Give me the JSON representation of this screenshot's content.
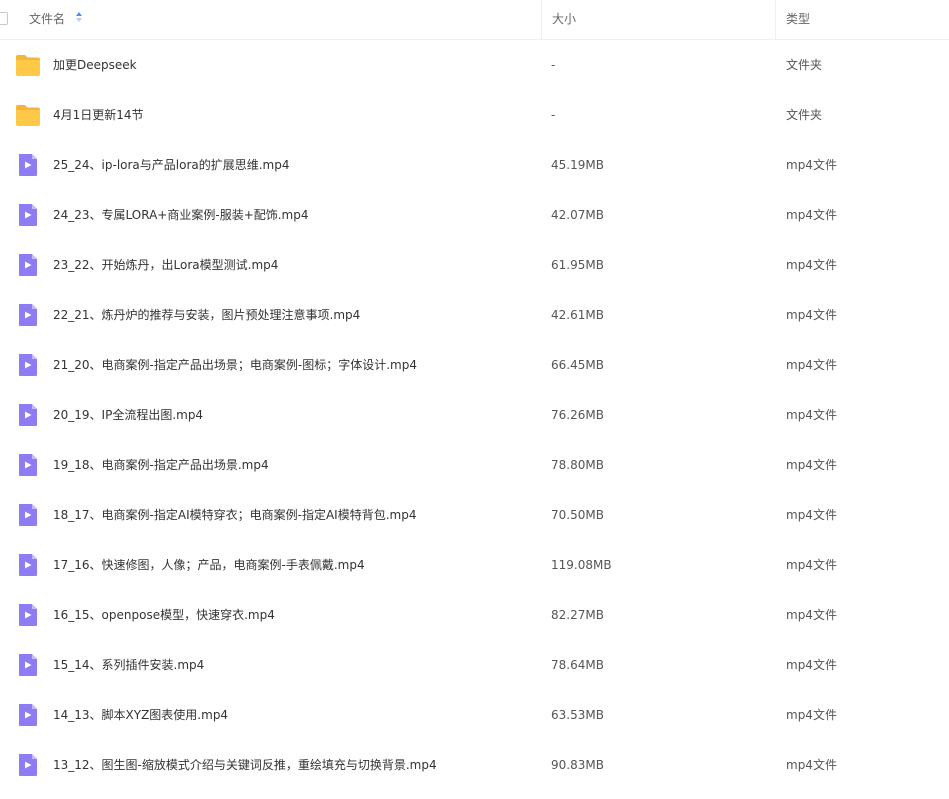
{
  "header": {
    "name_label": "文件名",
    "size_label": "大小",
    "type_label": "类型"
  },
  "rows": [
    {
      "kind": "folder",
      "icon": "folder-icon",
      "name": "加更Deepseek",
      "size": "-",
      "type": "文件夹"
    },
    {
      "kind": "folder",
      "icon": "folder-icon",
      "name": "4月1日更新14节",
      "size": "-",
      "type": "文件夹"
    },
    {
      "kind": "video",
      "icon": "video-file-icon",
      "name": "25_24、ip-lora与产品lora的扩展思维.mp4",
      "size": "45.19MB",
      "type": "mp4文件"
    },
    {
      "kind": "video",
      "icon": "video-file-icon",
      "name": "24_23、专属LORA+商业案例-服装+配饰.mp4",
      "size": "42.07MB",
      "type": "mp4文件"
    },
    {
      "kind": "video",
      "icon": "video-file-icon",
      "name": "23_22、开始炼丹，出Lora模型测试.mp4",
      "size": "61.95MB",
      "type": "mp4文件"
    },
    {
      "kind": "video",
      "icon": "video-file-icon",
      "name": "22_21、炼丹炉的推荐与安装，图片预处理注意事项.mp4",
      "size": "42.61MB",
      "type": "mp4文件"
    },
    {
      "kind": "video",
      "icon": "video-file-icon",
      "name": "21_20、电商案例-指定产品出场景；电商案例-图标；字体设计.mp4",
      "size": "66.45MB",
      "type": "mp4文件"
    },
    {
      "kind": "video",
      "icon": "video-file-icon",
      "name": "20_19、IP全流程出图.mp4",
      "size": "76.26MB",
      "type": "mp4文件"
    },
    {
      "kind": "video",
      "icon": "video-file-icon",
      "name": "19_18、电商案例-指定产品出场景.mp4",
      "size": "78.80MB",
      "type": "mp4文件"
    },
    {
      "kind": "video",
      "icon": "video-file-icon",
      "name": "18_17、电商案例-指定AI模特穿衣；电商案例-指定AI模特背包.mp4",
      "size": "70.50MB",
      "type": "mp4文件"
    },
    {
      "kind": "video",
      "icon": "video-file-icon",
      "name": "17_16、快速修图，人像；产品，电商案例-手表佩戴.mp4",
      "size": "119.08MB",
      "type": "mp4文件"
    },
    {
      "kind": "video",
      "icon": "video-file-icon",
      "name": "16_15、openpose模型，快速穿衣.mp4",
      "size": "82.27MB",
      "type": "mp4文件"
    },
    {
      "kind": "video",
      "icon": "video-file-icon",
      "name": "15_14、系列插件安装.mp4",
      "size": "78.64MB",
      "type": "mp4文件"
    },
    {
      "kind": "video",
      "icon": "video-file-icon",
      "name": "14_13、脚本XYZ图表使用.mp4",
      "size": "63.53MB",
      "type": "mp4文件"
    },
    {
      "kind": "video",
      "icon": "video-file-icon",
      "name": "13_12、图生图-缩放模式介绍与关键词反推，重绘填充与切换背景.mp4",
      "size": "90.83MB",
      "type": "mp4文件"
    }
  ],
  "colors": {
    "folder": "#ffc847",
    "folder_tab": "#f5b43a",
    "video": "#8e7cf5",
    "video_fold": "#c4baff",
    "sort_active": "#4a8df8"
  }
}
